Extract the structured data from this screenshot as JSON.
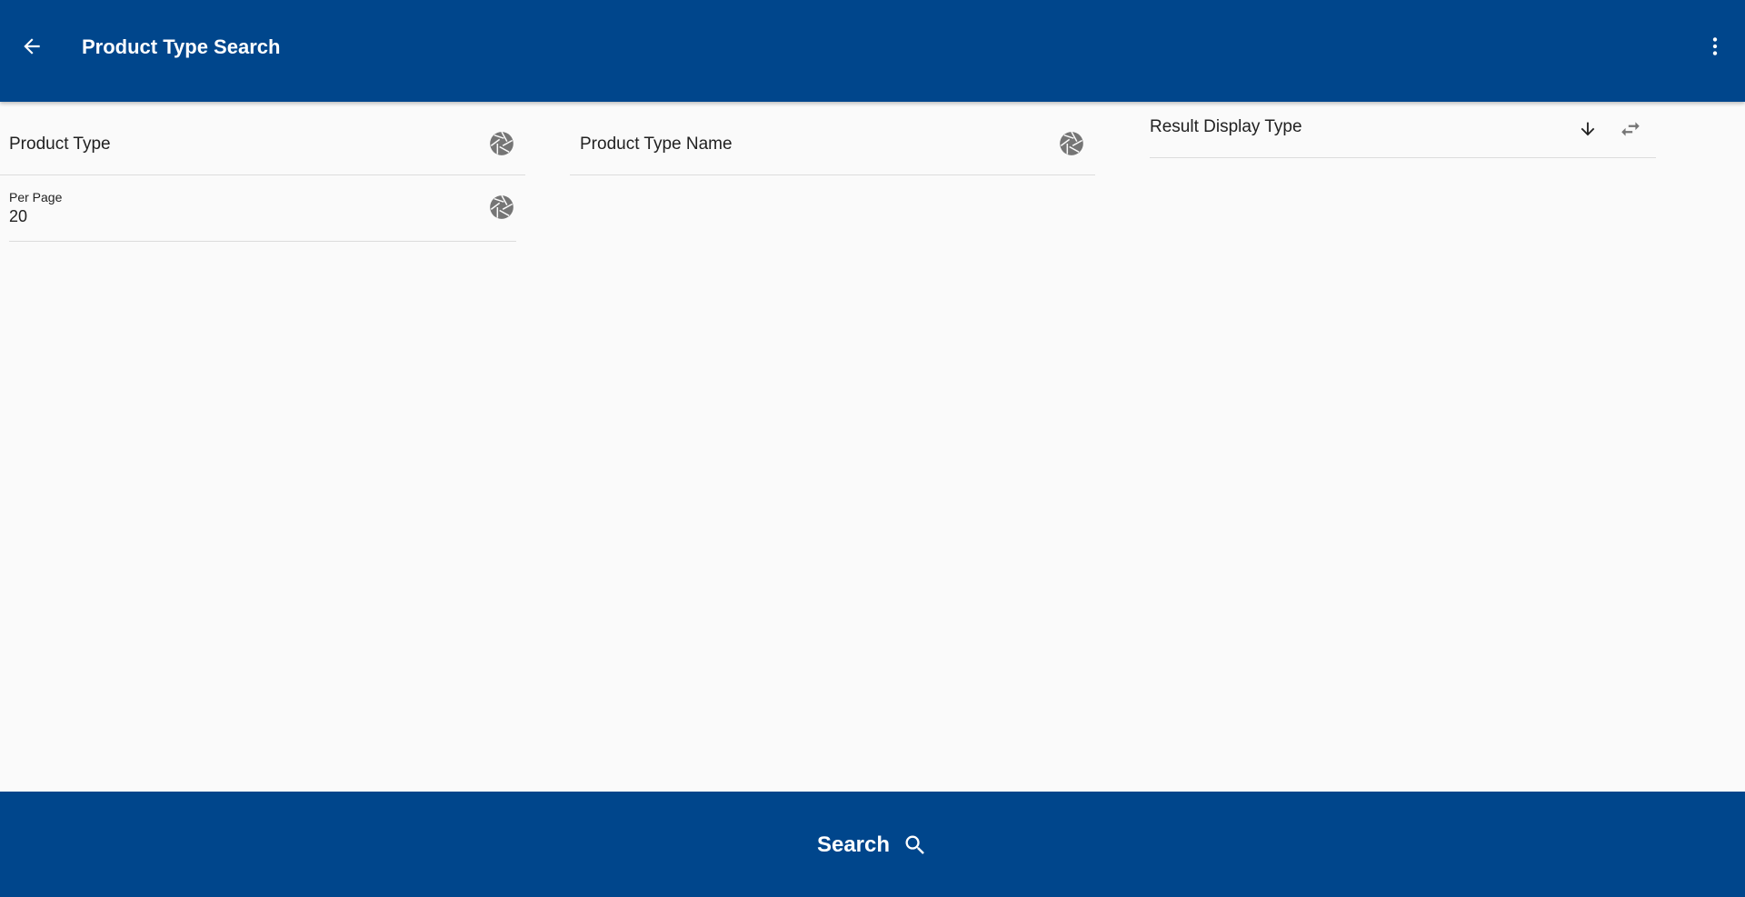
{
  "header": {
    "title": "Product Type Search",
    "back_icon": "arrow-left-icon",
    "menu_icon": "more-vert-icon"
  },
  "form": {
    "product_type": {
      "label": "Product Type",
      "icon": "aperture-icon",
      "value": ""
    },
    "product_type_name": {
      "label": "Product Type Name",
      "icon": "aperture-icon",
      "value": ""
    },
    "result_display_type": {
      "label": "Result Display Type",
      "icons": [
        "arrow-down-icon",
        "swap-horizontal-icon"
      ]
    },
    "per_page": {
      "label": "Per Page",
      "value": "20",
      "icon": "aperture-icon"
    }
  },
  "footer": {
    "search_label": "Search",
    "search_icon": "magnify-icon"
  },
  "colors": {
    "primary": "#00468c",
    "background": "#fafafa",
    "icon_gray": "#757575"
  }
}
